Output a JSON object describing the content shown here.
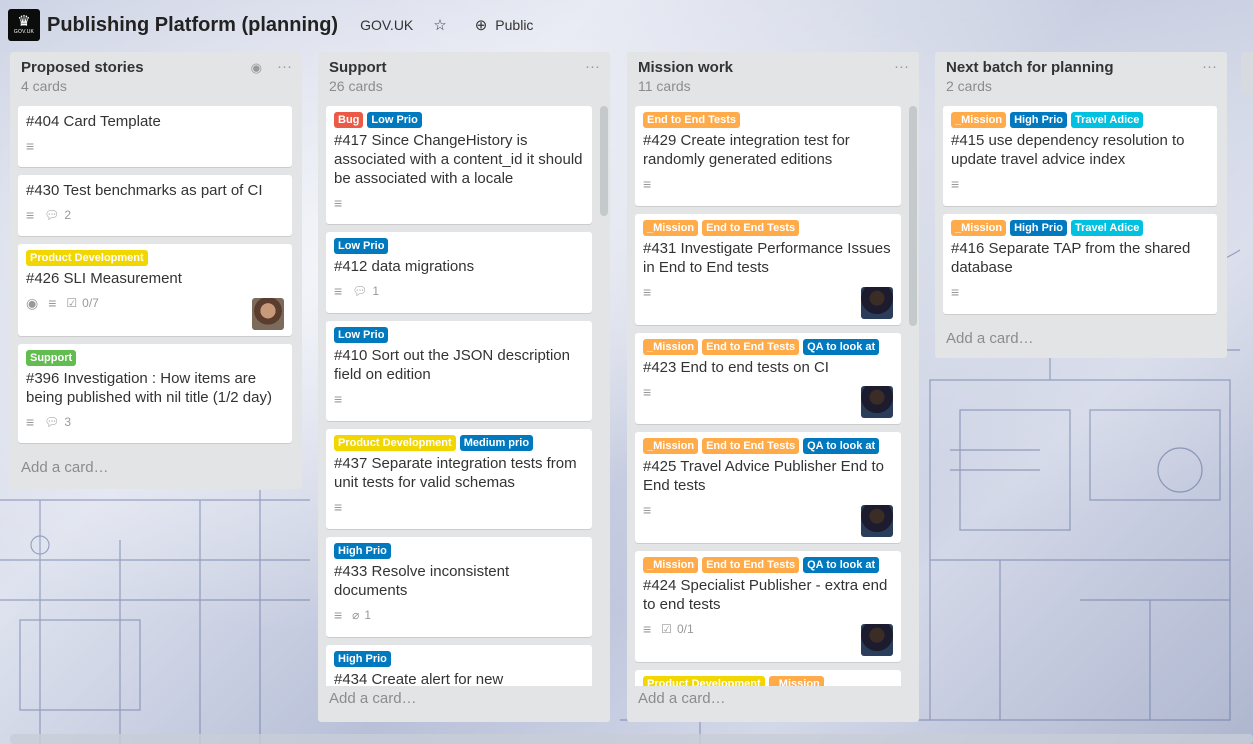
{
  "header": {
    "logo_text": "GOV.UK",
    "board_title": "Publishing Platform (planning)",
    "org": "GOV.UK",
    "visibility": "Public"
  },
  "colors": {
    "bug": "#eb5a46",
    "low_prio": "#0079bf",
    "product_development": "#f2d600",
    "support": "#61bd4f",
    "mission": "#ffab4a",
    "travel_advice": "#00c2e0"
  },
  "lists": [
    {
      "title": "Proposed stories",
      "count": "4 cards",
      "add_card": "Add a card…",
      "cards": [
        {
          "title": "#404 Card Template"
        },
        {
          "title": "#430 Test benchmarks as part of CI",
          "comments": "2"
        },
        {
          "labels": [
            "Product Development"
          ],
          "title": "#426 SLI Measurement",
          "checklist": "0/7"
        },
        {
          "labels": [
            "Support"
          ],
          "title": "#396 Investigation : How items are being published with nil title (1/2 day)",
          "comments": "3"
        }
      ]
    },
    {
      "title": "Support",
      "count": "26 cards",
      "add_card": "Add a card…",
      "cards": [
        {
          "labels": [
            "Bug",
            "Low Prio"
          ],
          "title": "#417 Since ChangeHistory is associated with a content_id it should be associated with a locale"
        },
        {
          "labels": [
            "Low Prio"
          ],
          "title": "#412 data migrations",
          "comments": "1"
        },
        {
          "labels": [
            "Low Prio"
          ],
          "title": "#410 Sort out the JSON description field on edition"
        },
        {
          "labels": [
            "Product Development",
            "Medium prio"
          ],
          "title": "#437 Separate integration tests from unit tests for valid schemas"
        },
        {
          "labels": [
            "High Prio"
          ],
          "title": "#433 Resolve inconsistent documents",
          "attachments": "1"
        },
        {
          "labels": [
            "High Prio"
          ],
          "title": "#434 Create alert for new"
        }
      ]
    },
    {
      "title": "Mission work",
      "count": "11 cards",
      "add_card": "Add a card…",
      "cards": [
        {
          "labels": [
            "End to End Tests"
          ],
          "title": "#429 Create integration test for randomly generated editions"
        },
        {
          "labels": [
            "_Mission",
            "End to End Tests"
          ],
          "title": "#431 Investigate Performance Issues in End to End tests"
        },
        {
          "labels": [
            "_Mission",
            "End to End Tests",
            "QA to look at"
          ],
          "title": "#423 End to end tests on CI"
        },
        {
          "labels": [
            "_Mission",
            "End to End Tests",
            "QA to look at"
          ],
          "title": "#425 Travel Advice Publisher End to End tests"
        },
        {
          "labels": [
            "_Mission",
            "End to End Tests",
            "QA to look at"
          ],
          "title": "#424 Specialist Publisher - extra end to end tests",
          "checklist": "0/1"
        },
        {
          "labels": [
            "Product Development",
            "_Mission"
          ]
        }
      ]
    },
    {
      "title": "Next batch for planning",
      "count": "2 cards",
      "add_card": "Add a card…",
      "cards": [
        {
          "labels": [
            "_Mission",
            "High Prio",
            "Travel Adice"
          ],
          "title": "#415 use dependency resolution to update travel advice index"
        },
        {
          "labels": [
            "_Mission",
            "High Prio",
            "Travel Adice"
          ],
          "title": "#416 Separate TAP from the shared database"
        }
      ]
    }
  ]
}
